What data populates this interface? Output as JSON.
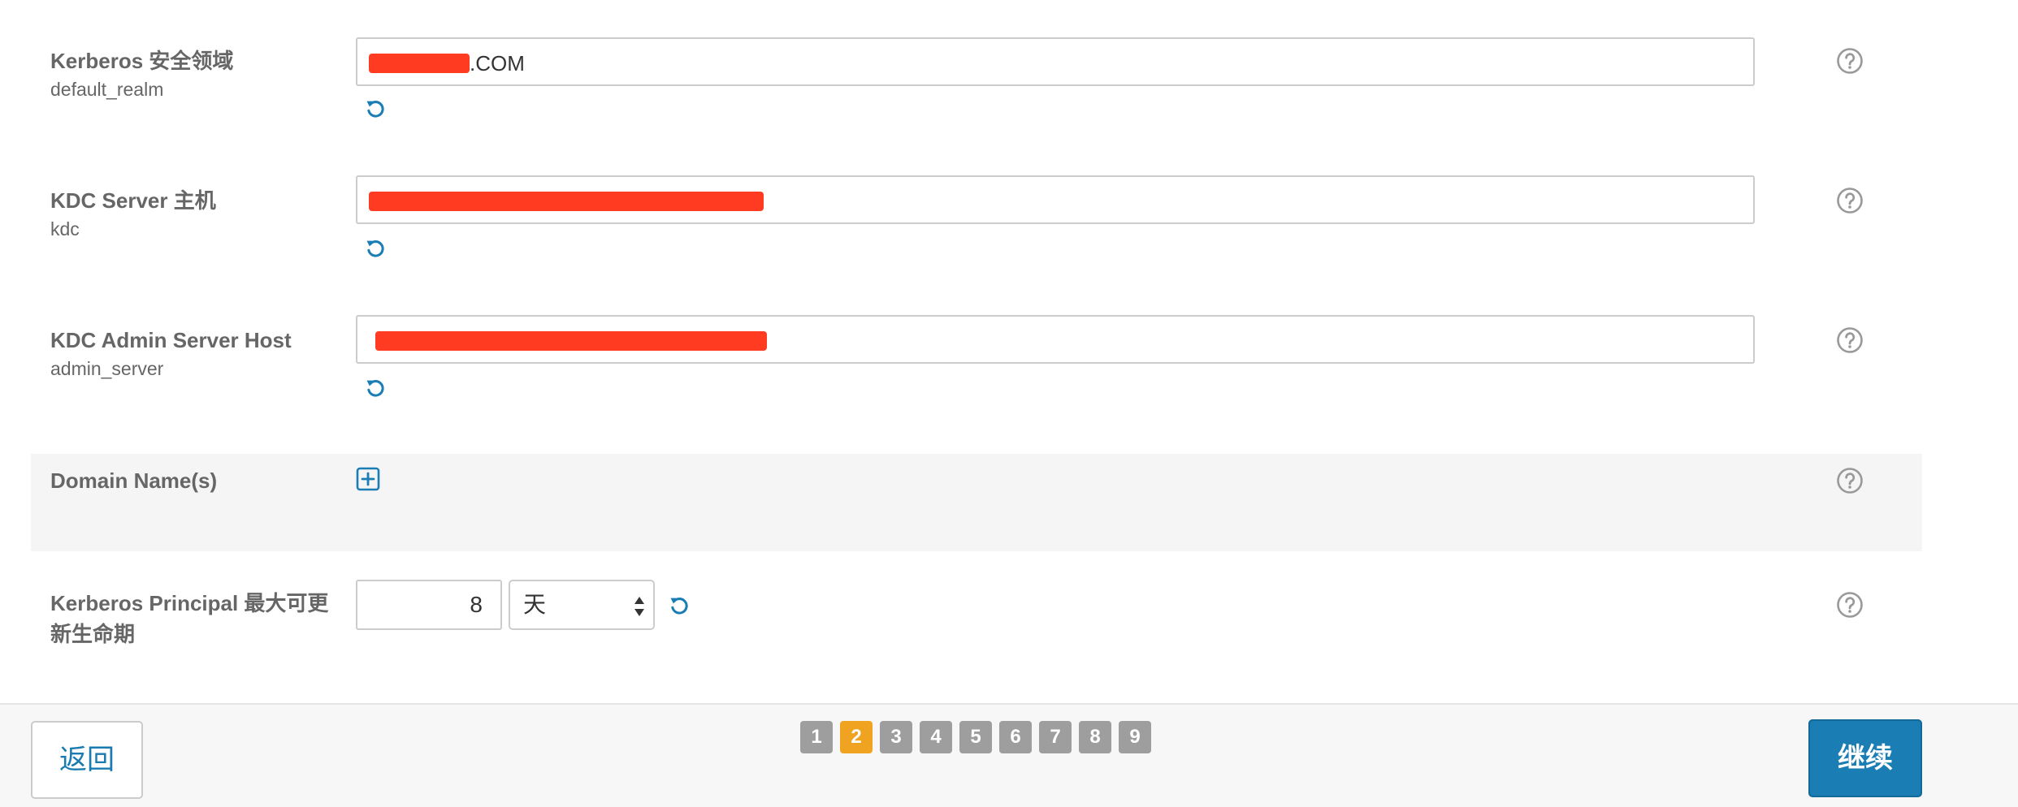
{
  "fields": {
    "realm": {
      "label": "Kerberos 安全领域",
      "sub": "default_realm",
      "value_suffix": ".COM"
    },
    "kdc": {
      "label": "KDC Server 主机",
      "sub": "kdc"
    },
    "admin": {
      "label": "KDC Admin Server Host",
      "sub": "admin_server"
    },
    "domains": {
      "label": "Domain Name(s)"
    },
    "lifetime": {
      "label_line1": "Kerberos Principal 最大可更",
      "label_line2": "新生命期",
      "value": "8",
      "unit": "天"
    }
  },
  "footer": {
    "back_label": "返回",
    "continue_label": "继续",
    "pages": [
      "1",
      "2",
      "3",
      "4",
      "5",
      "6",
      "7",
      "8",
      "9"
    ],
    "current_page": "2"
  },
  "colors": {
    "accent_blue": "#1a7db4",
    "current_page": "#f0a320",
    "page_inactive": "#9e9e9e",
    "redaction": "#ff3b22"
  }
}
